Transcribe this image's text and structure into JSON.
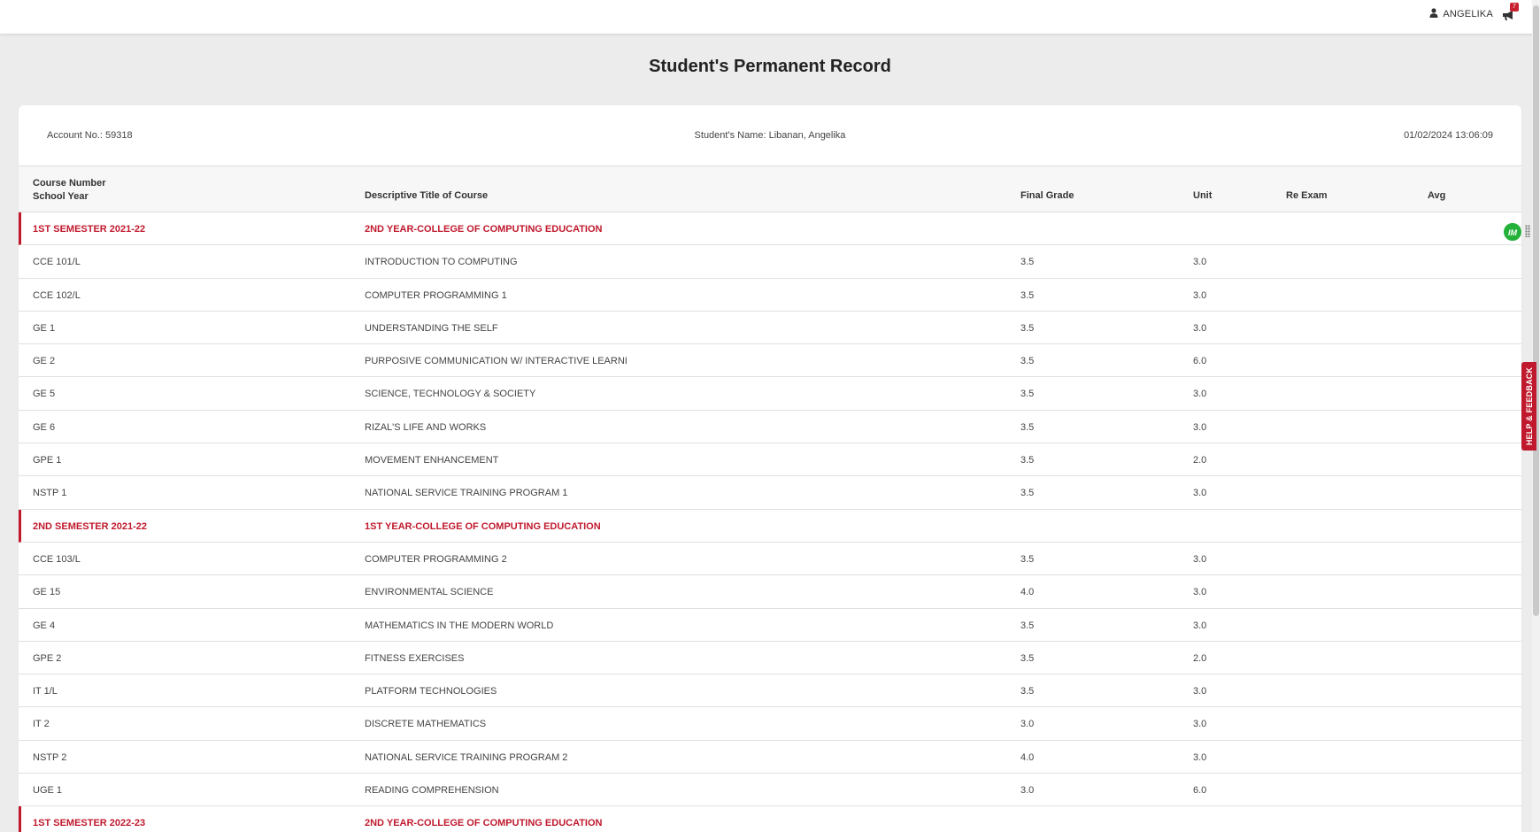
{
  "header": {
    "username": "ANGELIKA",
    "notification_count": "7",
    "icons": [
      "user-icon",
      "megaphone-icon"
    ]
  },
  "page_title": "Student's Permanent Record",
  "meta": {
    "account": "Account No.: 59318",
    "student_name": "Student's Name: Libanan, Angelika",
    "timestamp": "01/02/2024 13:06:09"
  },
  "table": {
    "headers": {
      "course_number": "Course Number",
      "school_year": "School Year",
      "title": "Descriptive Title of Course",
      "final_grade": "Final Grade",
      "unit": "Unit",
      "re_exam": "Re Exam",
      "avg": "Avg"
    },
    "rows": [
      {
        "type": "sem",
        "code": "1ST SEMESTER 2021-22",
        "title": "2ND YEAR-COLLEGE OF COMPUTING EDUCATION",
        "grade": "",
        "unit": "",
        "reexam": "",
        "avg": ""
      },
      {
        "type": "course",
        "code": "CCE 101/L",
        "title": "INTRODUCTION TO COMPUTING",
        "grade": "3.5",
        "unit": "3.0",
        "reexam": "",
        "avg": ""
      },
      {
        "type": "course",
        "code": "CCE 102/L",
        "title": "COMPUTER PROGRAMMING 1",
        "grade": "3.5",
        "unit": "3.0",
        "reexam": "",
        "avg": ""
      },
      {
        "type": "course",
        "code": "GE 1",
        "title": "UNDERSTANDING THE SELF",
        "grade": "3.5",
        "unit": "3.0",
        "reexam": "",
        "avg": ""
      },
      {
        "type": "course",
        "code": "GE 2",
        "title": "PURPOSIVE COMMUNICATION W/ INTERACTIVE LEARNI",
        "grade": "3.5",
        "unit": "6.0",
        "reexam": "",
        "avg": ""
      },
      {
        "type": "course",
        "code": "GE 5",
        "title": "SCIENCE, TECHNOLOGY & SOCIETY",
        "grade": "3.5",
        "unit": "3.0",
        "reexam": "",
        "avg": ""
      },
      {
        "type": "course",
        "code": "GE 6",
        "title": "RIZAL'S LIFE AND WORKS",
        "grade": "3.5",
        "unit": "3.0",
        "reexam": "",
        "avg": ""
      },
      {
        "type": "course",
        "code": "GPE 1",
        "title": "MOVEMENT ENHANCEMENT",
        "grade": "3.5",
        "unit": "2.0",
        "reexam": "",
        "avg": ""
      },
      {
        "type": "course",
        "code": "NSTP 1",
        "title": "NATIONAL SERVICE TRAINING PROGRAM 1",
        "grade": "3.5",
        "unit": "3.0",
        "reexam": "",
        "avg": ""
      },
      {
        "type": "sem",
        "code": "2ND SEMESTER 2021-22",
        "title": "1ST YEAR-COLLEGE OF COMPUTING EDUCATION",
        "grade": "",
        "unit": "",
        "reexam": "",
        "avg": ""
      },
      {
        "type": "course",
        "code": "CCE 103/L",
        "title": "COMPUTER PROGRAMMING 2",
        "grade": "3.5",
        "unit": "3.0",
        "reexam": "",
        "avg": ""
      },
      {
        "type": "course",
        "code": "GE 15",
        "title": "ENVIRONMENTAL SCIENCE",
        "grade": "4.0",
        "unit": "3.0",
        "reexam": "",
        "avg": ""
      },
      {
        "type": "course",
        "code": "GE 4",
        "title": "MATHEMATICS IN THE MODERN WORLD",
        "grade": "3.5",
        "unit": "3.0",
        "reexam": "",
        "avg": ""
      },
      {
        "type": "course",
        "code": "GPE 2",
        "title": "FITNESS EXERCISES",
        "grade": "3.5",
        "unit": "2.0",
        "reexam": "",
        "avg": ""
      },
      {
        "type": "course",
        "code": "IT 1/L",
        "title": "PLATFORM TECHNOLOGIES",
        "grade": "3.5",
        "unit": "3.0",
        "reexam": "",
        "avg": ""
      },
      {
        "type": "course",
        "code": "IT 2",
        "title": "DISCRETE MATHEMATICS",
        "grade": "3.0",
        "unit": "3.0",
        "reexam": "",
        "avg": ""
      },
      {
        "type": "course",
        "code": "NSTP 2",
        "title": "NATIONAL SERVICE TRAINING PROGRAM 2",
        "grade": "4.0",
        "unit": "3.0",
        "reexam": "",
        "avg": ""
      },
      {
        "type": "course",
        "code": "UGE 1",
        "title": "READING COMPREHENSION",
        "grade": "3.0",
        "unit": "6.0",
        "reexam": "",
        "avg": ""
      },
      {
        "type": "sem",
        "code": "1ST SEMESTER 2022-23",
        "title": "2ND YEAR-COLLEGE OF COMPUTING EDUCATION",
        "grade": "",
        "unit": "",
        "reexam": "",
        "avg": ""
      }
    ]
  },
  "widgets": {
    "im_badge": "IM",
    "help_feedback": "HELP & FEEDBACK"
  },
  "colors": {
    "accent_red": "#c0192d",
    "badge_green": "#23b13a",
    "background": "#ececec"
  }
}
